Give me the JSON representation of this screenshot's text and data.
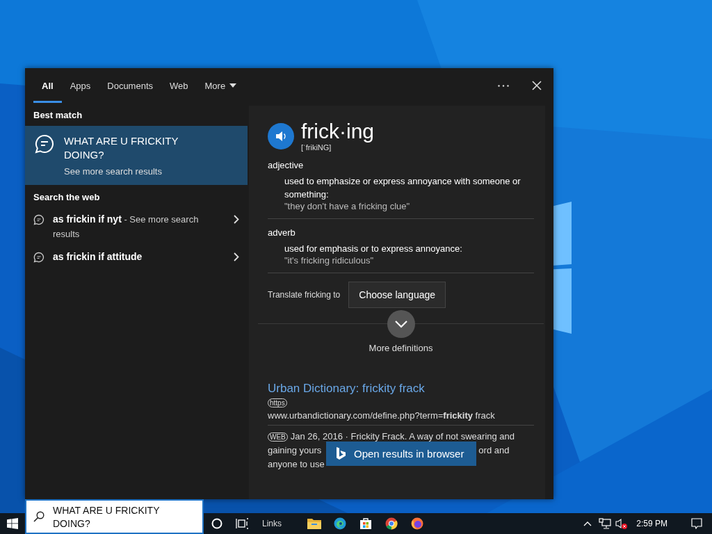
{
  "tabs": [
    {
      "label": "All",
      "selected": true,
      "kind": "plain"
    },
    {
      "label": "Apps",
      "selected": false,
      "kind": "plain"
    },
    {
      "label": "Documents",
      "selected": false,
      "kind": "plain"
    },
    {
      "label": "Web",
      "selected": false,
      "kind": "plain"
    },
    {
      "label": "More",
      "selected": false,
      "kind": "dropdown"
    }
  ],
  "best_match": {
    "heading": "Best match",
    "title": "WHAT ARE U FRICKITY DOING?",
    "subtitle": "See more search results",
    "selected": true
  },
  "web": {
    "heading": "Search the web",
    "items": [
      {
        "query": "as frickin if nyt",
        "suffix": "- See more search results"
      },
      {
        "query": "as frickin if attitude"
      }
    ]
  },
  "definition": {
    "word": "frick·ing",
    "pronunciation": "[ˈfrikiNG]",
    "senses": [
      {
        "part": "adjective",
        "meaning": "used to emphasize or express annoyance with someone or something:",
        "example": "\"they don't have a fricking clue\""
      },
      {
        "part": "adverb",
        "meaning": "used for emphasis or to express annoyance:",
        "example": "\"it's fricking ridiculous\""
      }
    ],
    "translate_label": "Translate fricking to",
    "language_button": "Choose language",
    "more": "More definitions"
  },
  "result": {
    "title": "Urban Dictionary: frickity frack",
    "badge": "https",
    "url": "www.urbandictionary.com/define.php?term=**frickity** frack",
    "snippet_badge": "WEB",
    "snippet_first": "Jan 26, 2016 · Frickity Frack. A way of not swearing and",
    "snippet_left": "gaining yours",
    "snippet_right": "ord and",
    "snippet_last": "anyone to use"
  },
  "open_button": "Open results in browser",
  "search_box": {
    "value": "WHAT ARE U FRICKITY DOING?"
  },
  "taskbar": {
    "toolbar": "Links",
    "clock": "2:59 PM"
  }
}
